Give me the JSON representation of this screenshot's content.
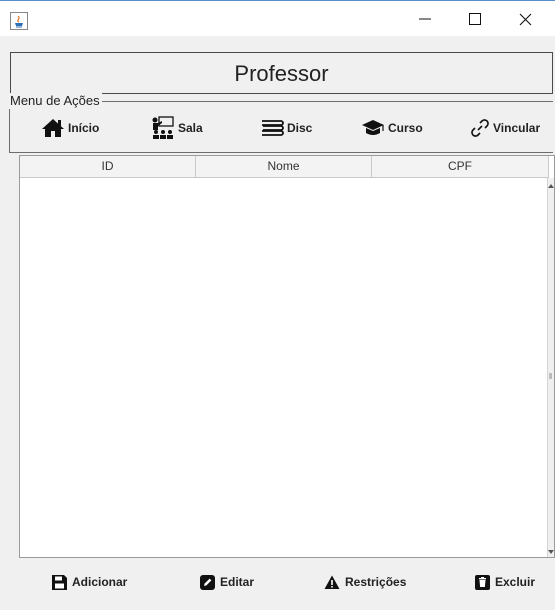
{
  "window": {
    "app_icon": "java-cup-icon",
    "controls": [
      "minimize-icon",
      "maximize-icon",
      "close-icon"
    ]
  },
  "header": {
    "title": "Professor"
  },
  "menu": {
    "legend": "Menu de Ações",
    "items": [
      {
        "label": "Início",
        "icon": "home-icon"
      },
      {
        "label": "Sala",
        "icon": "classroom-icon"
      },
      {
        "label": "Disc",
        "icon": "books-icon"
      },
      {
        "label": "Curso",
        "icon": "graduation-cap-icon"
      },
      {
        "label": "Vincular",
        "icon": "link-icon"
      }
    ]
  },
  "table": {
    "columns": [
      "ID",
      "Nome",
      "CPF"
    ],
    "rows": []
  },
  "actions": [
    {
      "label": "Adicionar",
      "icon": "save-icon"
    },
    {
      "label": "Editar",
      "icon": "edit-icon"
    },
    {
      "label": "Restrições",
      "icon": "warning-icon"
    },
    {
      "label": "Excluir",
      "icon": "trash-icon"
    }
  ]
}
